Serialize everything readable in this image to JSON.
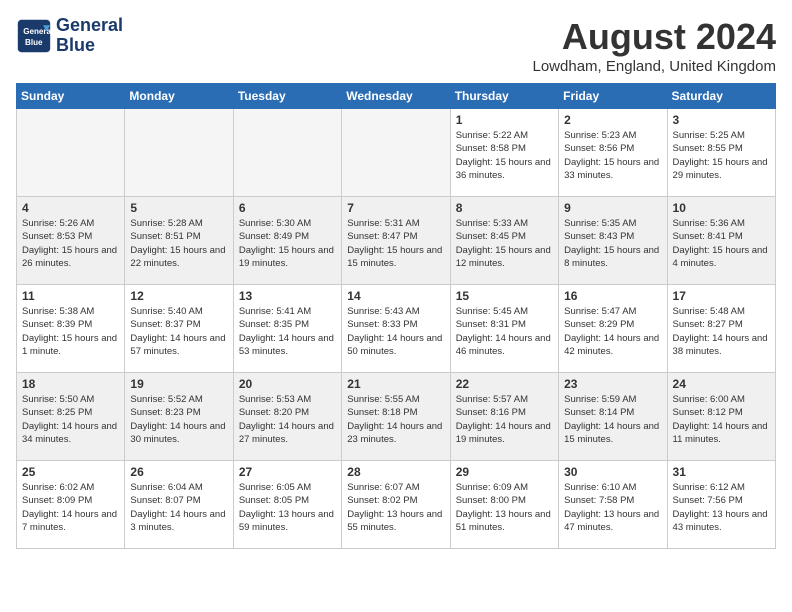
{
  "header": {
    "logo_line1": "General",
    "logo_line2": "Blue",
    "month_title": "August 2024",
    "location": "Lowdham, England, United Kingdom"
  },
  "days_of_week": [
    "Sunday",
    "Monday",
    "Tuesday",
    "Wednesday",
    "Thursday",
    "Friday",
    "Saturday"
  ],
  "weeks": [
    [
      {
        "day": "",
        "empty": true
      },
      {
        "day": "",
        "empty": true
      },
      {
        "day": "",
        "empty": true
      },
      {
        "day": "",
        "empty": true
      },
      {
        "day": "1",
        "sunrise": "Sunrise: 5:22 AM",
        "sunset": "Sunset: 8:58 PM",
        "daylight": "Daylight: 15 hours and 36 minutes."
      },
      {
        "day": "2",
        "sunrise": "Sunrise: 5:23 AM",
        "sunset": "Sunset: 8:56 PM",
        "daylight": "Daylight: 15 hours and 33 minutes."
      },
      {
        "day": "3",
        "sunrise": "Sunrise: 5:25 AM",
        "sunset": "Sunset: 8:55 PM",
        "daylight": "Daylight: 15 hours and 29 minutes."
      }
    ],
    [
      {
        "day": "4",
        "sunrise": "Sunrise: 5:26 AM",
        "sunset": "Sunset: 8:53 PM",
        "daylight": "Daylight: 15 hours and 26 minutes."
      },
      {
        "day": "5",
        "sunrise": "Sunrise: 5:28 AM",
        "sunset": "Sunset: 8:51 PM",
        "daylight": "Daylight: 15 hours and 22 minutes."
      },
      {
        "day": "6",
        "sunrise": "Sunrise: 5:30 AM",
        "sunset": "Sunset: 8:49 PM",
        "daylight": "Daylight: 15 hours and 19 minutes."
      },
      {
        "day": "7",
        "sunrise": "Sunrise: 5:31 AM",
        "sunset": "Sunset: 8:47 PM",
        "daylight": "Daylight: 15 hours and 15 minutes."
      },
      {
        "day": "8",
        "sunrise": "Sunrise: 5:33 AM",
        "sunset": "Sunset: 8:45 PM",
        "daylight": "Daylight: 15 hours and 12 minutes."
      },
      {
        "day": "9",
        "sunrise": "Sunrise: 5:35 AM",
        "sunset": "Sunset: 8:43 PM",
        "daylight": "Daylight: 15 hours and 8 minutes."
      },
      {
        "day": "10",
        "sunrise": "Sunrise: 5:36 AM",
        "sunset": "Sunset: 8:41 PM",
        "daylight": "Daylight: 15 hours and 4 minutes."
      }
    ],
    [
      {
        "day": "11",
        "sunrise": "Sunrise: 5:38 AM",
        "sunset": "Sunset: 8:39 PM",
        "daylight": "Daylight: 15 hours and 1 minute."
      },
      {
        "day": "12",
        "sunrise": "Sunrise: 5:40 AM",
        "sunset": "Sunset: 8:37 PM",
        "daylight": "Daylight: 14 hours and 57 minutes."
      },
      {
        "day": "13",
        "sunrise": "Sunrise: 5:41 AM",
        "sunset": "Sunset: 8:35 PM",
        "daylight": "Daylight: 14 hours and 53 minutes."
      },
      {
        "day": "14",
        "sunrise": "Sunrise: 5:43 AM",
        "sunset": "Sunset: 8:33 PM",
        "daylight": "Daylight: 14 hours and 50 minutes."
      },
      {
        "day": "15",
        "sunrise": "Sunrise: 5:45 AM",
        "sunset": "Sunset: 8:31 PM",
        "daylight": "Daylight: 14 hours and 46 minutes."
      },
      {
        "day": "16",
        "sunrise": "Sunrise: 5:47 AM",
        "sunset": "Sunset: 8:29 PM",
        "daylight": "Daylight: 14 hours and 42 minutes."
      },
      {
        "day": "17",
        "sunrise": "Sunrise: 5:48 AM",
        "sunset": "Sunset: 8:27 PM",
        "daylight": "Daylight: 14 hours and 38 minutes."
      }
    ],
    [
      {
        "day": "18",
        "sunrise": "Sunrise: 5:50 AM",
        "sunset": "Sunset: 8:25 PM",
        "daylight": "Daylight: 14 hours and 34 minutes."
      },
      {
        "day": "19",
        "sunrise": "Sunrise: 5:52 AM",
        "sunset": "Sunset: 8:23 PM",
        "daylight": "Daylight: 14 hours and 30 minutes."
      },
      {
        "day": "20",
        "sunrise": "Sunrise: 5:53 AM",
        "sunset": "Sunset: 8:20 PM",
        "daylight": "Daylight: 14 hours and 27 minutes."
      },
      {
        "day": "21",
        "sunrise": "Sunrise: 5:55 AM",
        "sunset": "Sunset: 8:18 PM",
        "daylight": "Daylight: 14 hours and 23 minutes."
      },
      {
        "day": "22",
        "sunrise": "Sunrise: 5:57 AM",
        "sunset": "Sunset: 8:16 PM",
        "daylight": "Daylight: 14 hours and 19 minutes."
      },
      {
        "day": "23",
        "sunrise": "Sunrise: 5:59 AM",
        "sunset": "Sunset: 8:14 PM",
        "daylight": "Daylight: 14 hours and 15 minutes."
      },
      {
        "day": "24",
        "sunrise": "Sunrise: 6:00 AM",
        "sunset": "Sunset: 8:12 PM",
        "daylight": "Daylight: 14 hours and 11 minutes."
      }
    ],
    [
      {
        "day": "25",
        "sunrise": "Sunrise: 6:02 AM",
        "sunset": "Sunset: 8:09 PM",
        "daylight": "Daylight: 14 hours and 7 minutes."
      },
      {
        "day": "26",
        "sunrise": "Sunrise: 6:04 AM",
        "sunset": "Sunset: 8:07 PM",
        "daylight": "Daylight: 14 hours and 3 minutes."
      },
      {
        "day": "27",
        "sunrise": "Sunrise: 6:05 AM",
        "sunset": "Sunset: 8:05 PM",
        "daylight": "Daylight: 13 hours and 59 minutes."
      },
      {
        "day": "28",
        "sunrise": "Sunrise: 6:07 AM",
        "sunset": "Sunset: 8:02 PM",
        "daylight": "Daylight: 13 hours and 55 minutes."
      },
      {
        "day": "29",
        "sunrise": "Sunrise: 6:09 AM",
        "sunset": "Sunset: 8:00 PM",
        "daylight": "Daylight: 13 hours and 51 minutes."
      },
      {
        "day": "30",
        "sunrise": "Sunrise: 6:10 AM",
        "sunset": "Sunset: 7:58 PM",
        "daylight": "Daylight: 13 hours and 47 minutes."
      },
      {
        "day": "31",
        "sunrise": "Sunrise: 6:12 AM",
        "sunset": "Sunset: 7:56 PM",
        "daylight": "Daylight: 13 hours and 43 minutes."
      }
    ]
  ]
}
